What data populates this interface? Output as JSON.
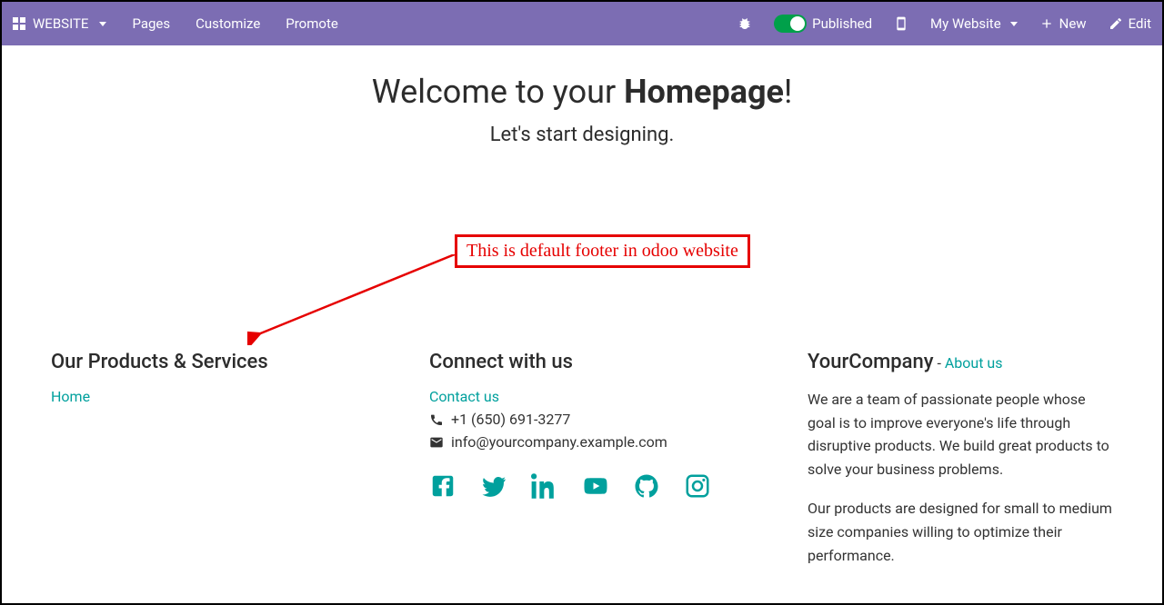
{
  "topbar": {
    "brand": "WEBSITE",
    "pages": "Pages",
    "customize": "Customize",
    "promote": "Promote",
    "published": "Published",
    "mywebsite": "My Website",
    "new": "New",
    "edit": "Edit"
  },
  "hero": {
    "welcome_prefix": "Welcome to your ",
    "welcome_bold": "Homepage",
    "welcome_suffix": "!",
    "subtitle": "Let's start designing."
  },
  "annotation": {
    "text": "This is default footer in odoo website"
  },
  "footer": {
    "col1": {
      "title": "Our Products & Services",
      "home": "Home"
    },
    "col2": {
      "title": "Connect with us",
      "contact": "Contact us",
      "phone": "+1 (650) 691-3277",
      "email": "info@yourcompany.example.com"
    },
    "col3": {
      "company": "YourCompany",
      "dash": " - ",
      "about": "About us",
      "para1": "We are a team of passionate people whose goal is to improve everyone's life through disruptive products. We build great products to solve your business problems.",
      "para2": "Our products are designed for small to medium size companies willing to optimize their performance."
    }
  }
}
